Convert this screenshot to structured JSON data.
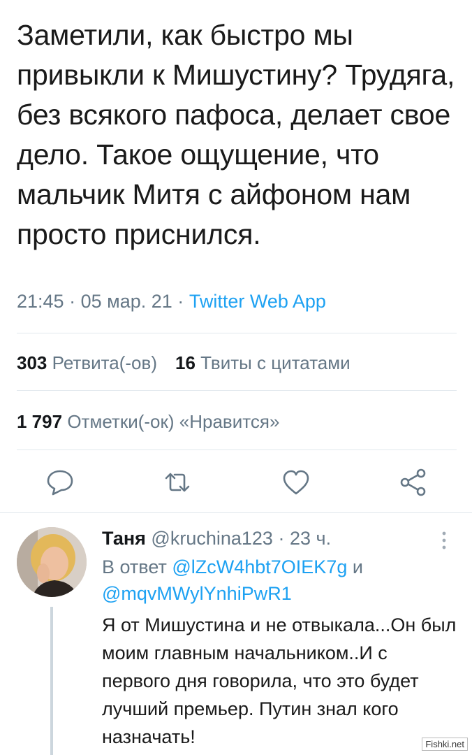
{
  "tweet": {
    "text": "Заметили, как быстро мы привыкли к Мишустину? Трудяга, без всякого пафоса, делает свое дело. Такое ощущение, что мальчик Митя с айфоном нам просто приснился.",
    "time": "21:45",
    "date": "05 мар. 21",
    "separator": "·",
    "source": "Twitter Web App",
    "retweets_count": "303",
    "retweets_label": "Ретвита(-ов)",
    "quotes_count": "16",
    "quotes_label": "Твиты с цитатами",
    "likes_count": "1 797",
    "likes_label": "Отметки(-ок) «Нравится»"
  },
  "actions": [
    {
      "icon": "reply-icon"
    },
    {
      "icon": "retweet-icon"
    },
    {
      "icon": "like-icon"
    },
    {
      "icon": "share-icon"
    }
  ],
  "reply": {
    "name": "Таня",
    "handle": "@kruchina123",
    "separator": "·",
    "time_ago": "23 ч.",
    "reply_to_label": "В ответ",
    "mention_1": "@lZcW4hbt7OIEK7g",
    "and_label": "и",
    "mention_2": "@mqvMWylYnhiPwR1",
    "text": "Я от Мишустина и не отвыкала...Он был моим главным начальником..И с первого дня говорила, что это будет лучший премьер. Путин знал кого назначать!"
  },
  "watermark": "Fishki.net",
  "colors": {
    "accent": "#1da1f2",
    "muted": "#657786",
    "text": "#14171a",
    "divider": "#e1e8ed"
  }
}
